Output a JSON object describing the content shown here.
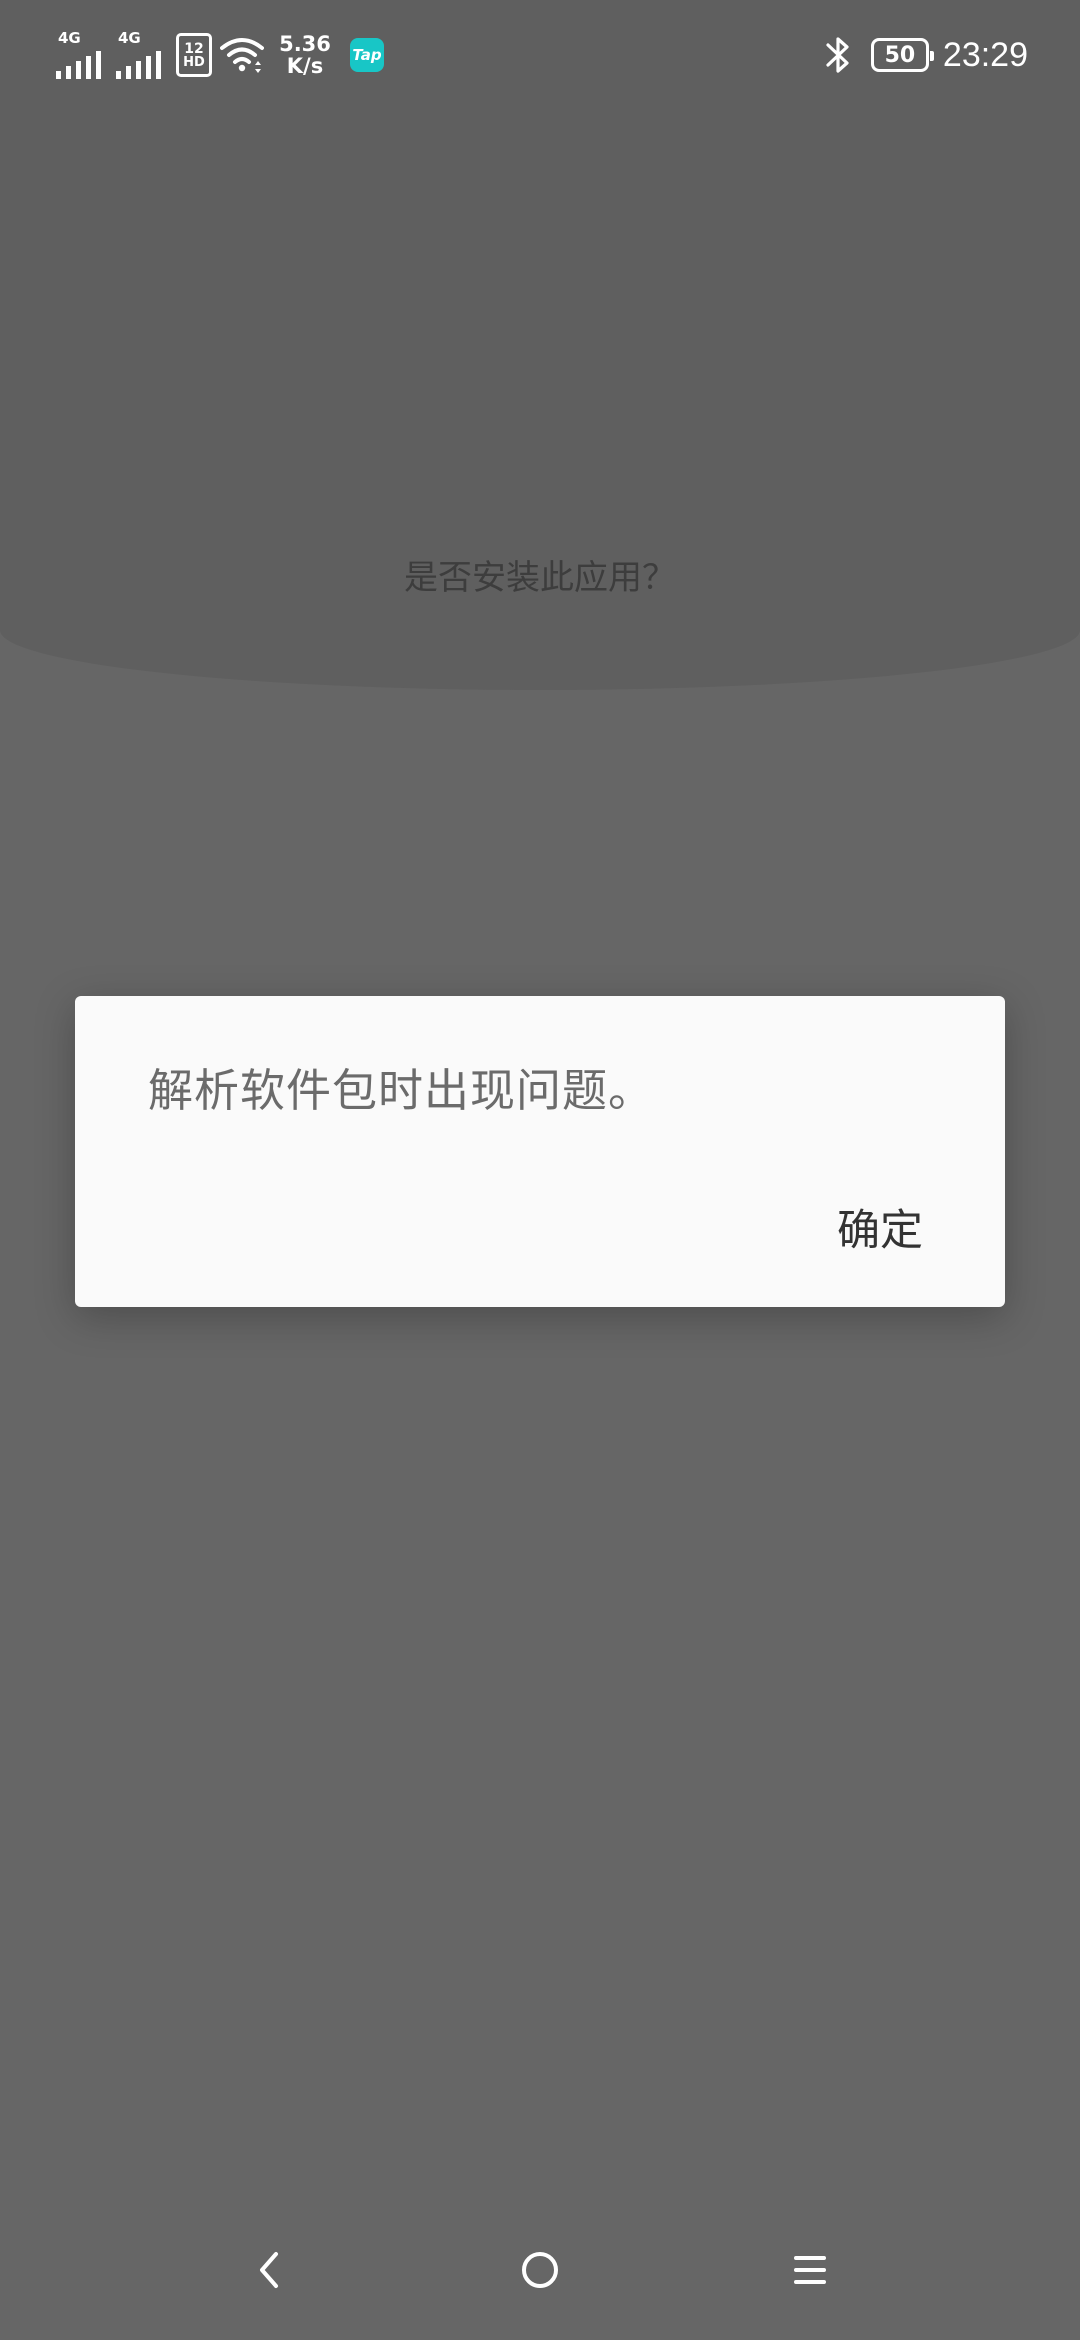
{
  "status_bar": {
    "sim1_network": "4G",
    "sim2_network": "4G",
    "sim_badge_top": "12",
    "sim_badge_bottom": "HD",
    "speed_value": "5.36",
    "speed_unit": "K/s",
    "tap_icon_label": "Tap",
    "battery_level": "50",
    "time": "23:29"
  },
  "background": {
    "install_question": "是否安装此应用？"
  },
  "dialog": {
    "message": "解析软件包时出现问题。",
    "ok_label": "确定"
  },
  "nav_bar": {
    "back_icon": "chevron-left-icon",
    "home_icon": "circle-home-icon",
    "recents_icon": "menu-lines-icon"
  },
  "colors": {
    "scrim": "#666666",
    "dialog_bg": "#fafafa",
    "tap_brand": "#18c6c6"
  }
}
